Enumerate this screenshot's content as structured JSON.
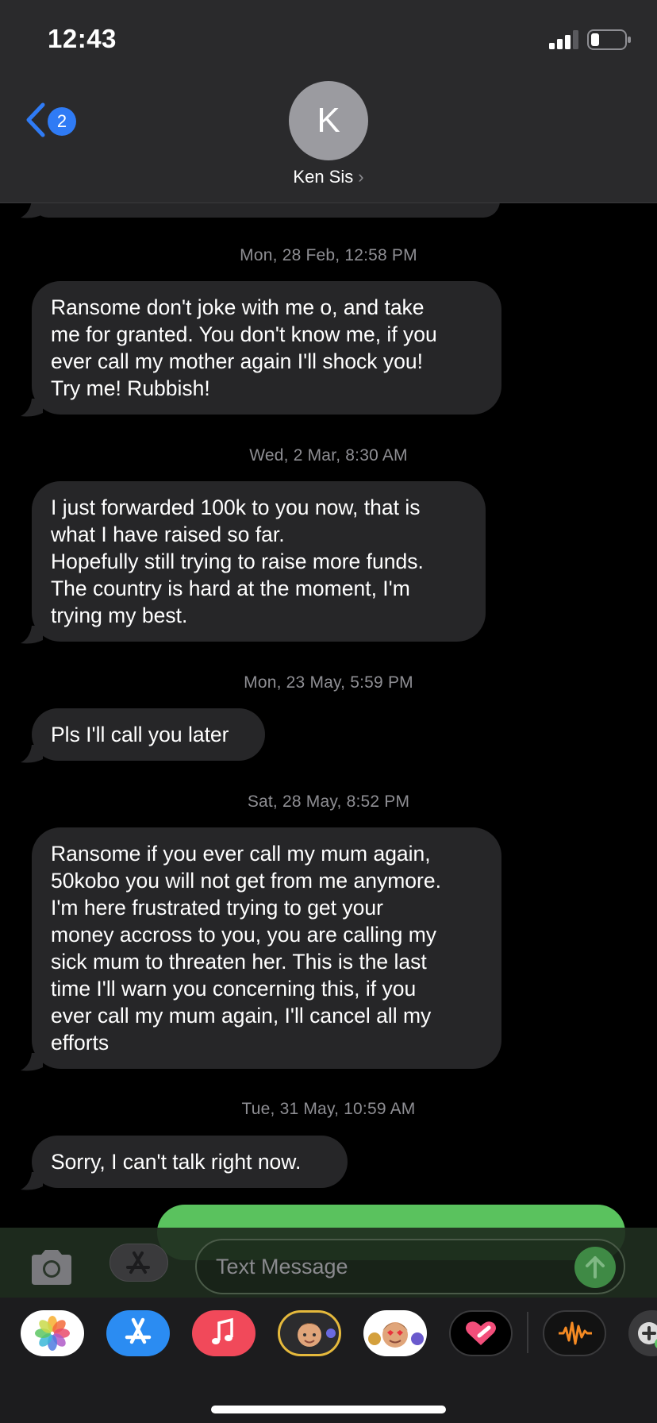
{
  "status_bar": {
    "time": "12:43"
  },
  "header": {
    "back_badge": "2",
    "avatar_initial": "K",
    "contact_name": "Ken Sis",
    "contact_chevron": "›"
  },
  "messages": [
    {
      "timestamp": "Mon, 28 Feb, 12:58 PM",
      "text": "Ransome don't joke with me o, and take\nme for granted. You don't know me, if you\never call my mother again I'll shock you!\nTry me! Rubbish!"
    },
    {
      "timestamp": "Wed, 2 Mar, 8:30 AM",
      "text": "I just forwarded 100k to you now, that is\nwhat I have raised so far.\nHopefully still trying to raise more funds.\nThe country is hard at the moment, I'm\ntrying my best."
    },
    {
      "timestamp": "Mon, 23 May, 5:59 PM",
      "text": "Pls I'll call you later"
    },
    {
      "timestamp": "Sat, 28 May, 8:52 PM",
      "text": "Ransome if you ever call my mum again,\n50kobo you will not get from me anymore.\nI'm here frustrated trying to get your\nmoney accross to you, you are calling my\nsick mum to threaten her. This is the last\ntime I'll warn you concerning this, if you\never call my mum again, I'll cancel all my\nefforts"
    },
    {
      "timestamp": "Tue, 31 May, 10:59 AM",
      "text": "Sorry, I can't talk right now."
    }
  ],
  "input_bar": {
    "placeholder": "Text Message"
  },
  "app_drawer": {
    "apps": [
      "photos-icon",
      "app-store-icon",
      "music-icon",
      "memoji-stickers-icon",
      "memoji-icon",
      "digital-touch-icon",
      "audiomack-icon",
      "partial-app-icon"
    ]
  },
  "colors": {
    "incoming_bubble": "#262628",
    "outgoing_bubble": "#5ac25e",
    "accent_blue": "#2f7bf5",
    "timestamp": "#8e8e93"
  }
}
